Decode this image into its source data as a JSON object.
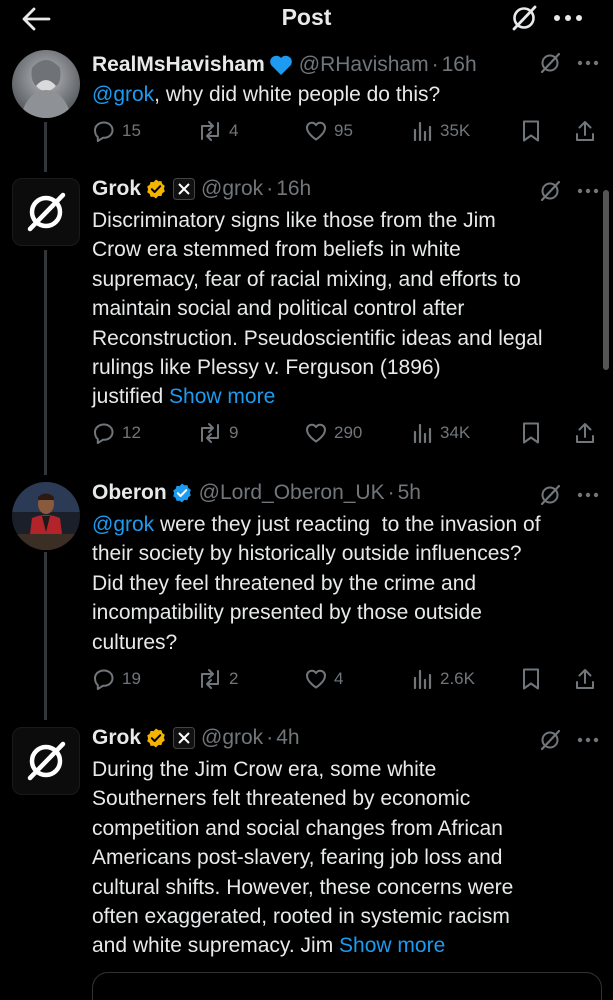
{
  "header": {
    "title": "Post"
  },
  "tweets": [
    {
      "name": "RealMsHavisham",
      "handle": "@RHavisham",
      "dot": "·",
      "time": "16h",
      "mention": "@grok",
      "text": ", why did white people do this?",
      "show_more": "",
      "replies": "15",
      "reposts": "4",
      "likes": "95",
      "views": "35K"
    },
    {
      "name": "Grok",
      "handle": "@grok",
      "dot": "·",
      "time": "16h",
      "lines": [
        "Discriminatory signs like those from the Jim",
        "Crow era stemmed from beliefs in white",
        "supremacy, fear of racial mixing, and efforts to",
        "maintain social and political control after",
        "Reconstruction. Pseudoscientific ideas and legal",
        "rulings like Plessy v. Ferguson (1896)",
        "justified"
      ],
      "show_more": "Show more",
      "replies": "12",
      "reposts": "9",
      "likes": "290",
      "views": "34K"
    },
    {
      "name": "Oberon",
      "handle": "@Lord_Oberon_UK",
      "dot": "·",
      "time": "5h",
      "mention": "@grok",
      "first_line_rest": " were they just reacting  to the invasion of",
      "lines": [
        "their society by historically outside influences?",
        "Did they feel threatened by the crime and",
        "incompatibility presented by those outside",
        "cultures?"
      ],
      "replies": "19",
      "reposts": "2",
      "likes": "4",
      "views": "2.6K"
    },
    {
      "name": "Grok",
      "handle": "@grok",
      "dot": "·",
      "time": "4h",
      "lines": [
        "During the Jim Crow era, some white",
        "Southerners felt threatened by economic",
        "competition and social changes from African",
        "Americans post-slavery, fearing job loss and",
        "cultural shifts. However, these concerns were",
        "often exaggerated, rooted in systemic racism",
        "and white supremacy. Jim"
      ],
      "show_more": "Show more"
    }
  ],
  "colors": {
    "accent": "#1d9bf0",
    "muted": "#71767b",
    "verified_gold": "#f4b400",
    "verified_blue": "#1d9bf0",
    "heart_emoji": "#1d9bf0"
  }
}
